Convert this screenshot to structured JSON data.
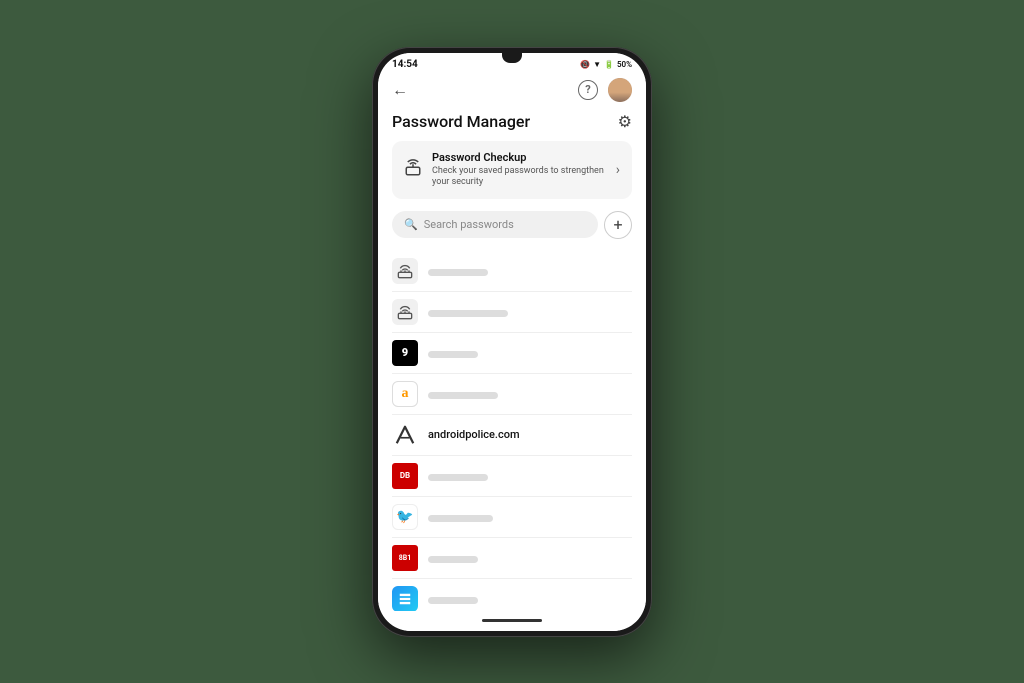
{
  "status_bar": {
    "time": "14:54",
    "battery": "50%",
    "battery_icon": "🔋"
  },
  "nav": {
    "back_label": "←",
    "help_label": "?",
    "settings_icon": "⚙"
  },
  "page": {
    "title": "Password Manager"
  },
  "checkup": {
    "title": "Password Checkup",
    "description": "Check your saved passwords to strengthen your security",
    "arrow": "›"
  },
  "search": {
    "placeholder": "Search passwords",
    "add_label": "+"
  },
  "passwords": [
    {
      "id": 1,
      "icon_type": "router",
      "site": "",
      "username_width": 60
    },
    {
      "id": 2,
      "icon_type": "router",
      "site": "",
      "username_width": 80
    },
    {
      "id": 3,
      "icon_type": "9gag",
      "icon_text": "9",
      "site": "",
      "username_width": 50
    },
    {
      "id": 4,
      "icon_type": "amazon",
      "icon_text": "a",
      "site": "",
      "username_width": 70
    },
    {
      "id": 5,
      "icon_type": "ap",
      "site": "androidpolice.com",
      "username_width": 0
    },
    {
      "id": 6,
      "icon_type": "db",
      "icon_text": "DB",
      "site": "",
      "username_width": 60
    },
    {
      "id": 7,
      "icon_type": "bluebird",
      "icon_text": "🐦",
      "site": "",
      "username_width": 65
    },
    {
      "id": 8,
      "icon_type": "881",
      "icon_text": "8B1",
      "site": "",
      "username_width": 55
    },
    {
      "id": 9,
      "icon_type": "blue-gradient",
      "site": "",
      "username_width": 50
    }
  ]
}
